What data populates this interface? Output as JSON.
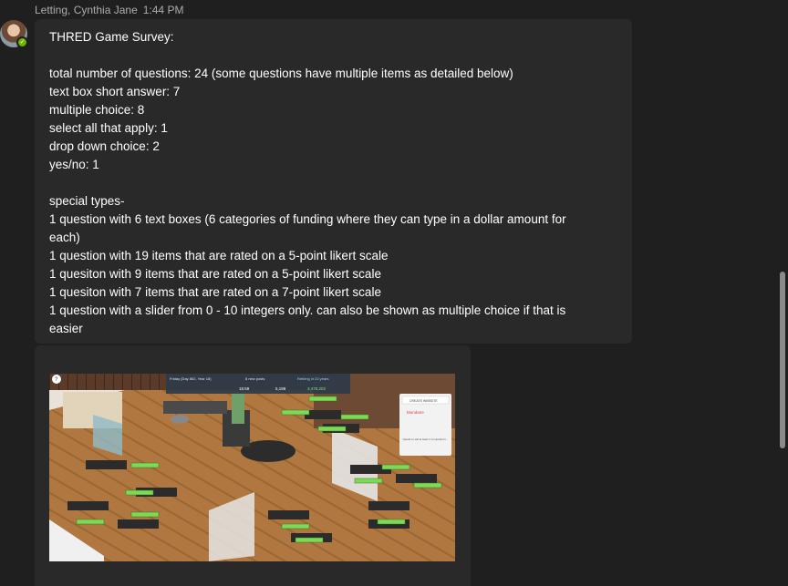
{
  "message": {
    "sender": "Letting, Cynthia Jane",
    "time": "1:44 PM",
    "lines": [
      "THRED Game Survey:",
      "",
      "total number of questions: 24 (some questions have multiple items as detailed below)",
      "text box short answer: 7",
      "multiple choice: 8",
      "select all that apply: 1",
      "drop down choice: 2",
      "yes/no: 1",
      "",
      "special types-",
      "1 question with 6 text boxes (6 categories of funding where they can type in a dollar amount for",
      "each)",
      "1 question with 19 items that are rated on a 5-point likert scale",
      "1 quesiton with 9 items that are rated on a 5-point likert scale",
      "1 quesiton with 7 items that are rated on a 7-point likert scale",
      "1 question with a slider from 0 - 10 integers only. can also be shown as multiple choice if that is",
      "easier"
    ]
  },
  "presence": {
    "status": "available",
    "color": "#6bb700"
  },
  "attachment": {
    "hud": {
      "date": "Friday (Day 862, Year 18)",
      "staff": "8 new posts",
      "retire": "Retiring in 22 years",
      "clock": "16:59",
      "rate": "5,198",
      "money": "3,478,202"
    },
    "panel": {
      "title": "CREATE WEBSITE",
      "game": "Mundane",
      "note": "Needs to sell at least 1 competitor's..."
    }
  }
}
